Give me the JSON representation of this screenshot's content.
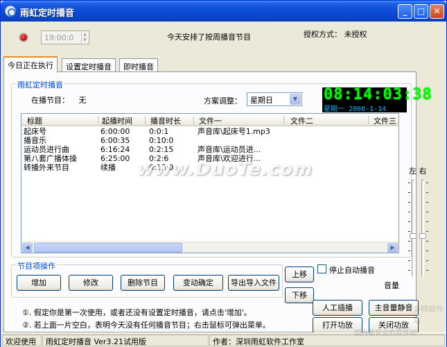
{
  "window": {
    "title": "雨虹定时播音",
    "min_label": "_",
    "max_label": "□",
    "close_label": "✕"
  },
  "top": {
    "time_value": "19:00:0",
    "today_note": "今天安排了按周播音节目",
    "auth_label": "授权方式：",
    "auth_value": "未授权"
  },
  "tabs": [
    {
      "label": "今日正在执行",
      "active": true
    },
    {
      "label": "设置定时播音",
      "active": false
    },
    {
      "label": "即时播音",
      "active": false
    }
  ],
  "broadcast_group": {
    "title": "雨虹定时播音",
    "now_playing_label": "在播节目：",
    "now_playing_value": "无",
    "plan_label": "方案调整：",
    "plan_value": "星期日"
  },
  "clock": {
    "time": "08:14:03:38",
    "date": "星期一  2008-1-14"
  },
  "list": {
    "columns": [
      "标题",
      "起播时间",
      "播音时长",
      "文件一",
      "文件二",
      "文件三"
    ],
    "rows": [
      {
        "title": "起床号",
        "start": "6:00:00",
        "duration": "0:0:1",
        "file1": "声音库\\起床号1.mp3",
        "file2": ""
      },
      {
        "title": "播音乐",
        "start": "6:00:35",
        "duration": "0:10:0",
        "file1": "",
        "file2": ""
      },
      {
        "title": "运动员进行曲",
        "start": "6:16:24",
        "duration": "0:2:15",
        "file1": "声音库\\运动员进...",
        "file2": ""
      },
      {
        "title": "第八套广播体操",
        "start": "6:25:00",
        "duration": "0:2:6",
        "file1": "声音库\\欢迎进行...",
        "file2": ""
      },
      {
        "title": "转播外来节目",
        "start": "续播",
        "duration": "0:15:0",
        "file1": "",
        "file2": ""
      }
    ]
  },
  "ops_group": {
    "title": "节目项操作",
    "buttons": [
      "增加",
      "修改",
      "删除节目",
      "变动确定",
      "导出导入文件"
    ]
  },
  "move": {
    "up": "上移",
    "down": "下移"
  },
  "auto_stop": {
    "label": "停止自动播音",
    "checked": false
  },
  "volume": {
    "left_right": "左 右",
    "label": "音量",
    "left_level": 0.42,
    "right_level": 0.42
  },
  "side_buttons": {
    "manual_insert": "人工插播",
    "mute_main": "主音量静音",
    "amp_on": "打开功放",
    "amp_off": "关闭功放"
  },
  "tips": [
    "①. 假定你是第一次使用，或者还没有设置定时播音，请点击'增加'。",
    "②. 若上面一片空白，表明今天没有任何播音节目；右击鼠标可弹出菜单。"
  ],
  "status": {
    "welcome": "欢迎使用",
    "version": "雨虹定时播音 Ver3.21试用版",
    "author": "作者：深圳雨虹软件工作室"
  },
  "watermark": {
    "text": "www.DuoTe.com",
    "corner1": "多特软件站",
    "corner2": "国内最安全的软件站"
  }
}
